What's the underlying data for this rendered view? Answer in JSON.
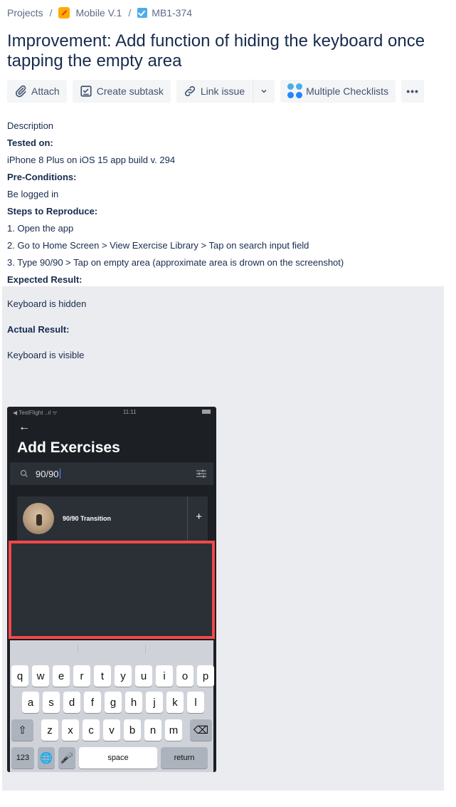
{
  "breadcrumb": {
    "projects": "Projects",
    "separator": "/",
    "project": "Mobile V.1",
    "issue_key": "MB1-374"
  },
  "issue_title": "Improvement: Add function of hiding the keyboard once tapping the empty area",
  "toolbar": {
    "attach": "Attach",
    "create_subtask": "Create subtask",
    "link_issue": "Link issue",
    "multiple_checklists": "Multiple Checklists",
    "more": "•••"
  },
  "description": {
    "heading": "Description",
    "tested_on_label": "Tested on:",
    "tested_on": "iPhone 8 Plus on iOS 15 app build v. 294",
    "preconditions_label": "Pre-Conditions:",
    "preconditions": "Be logged in",
    "steps_label": "Steps to Reproduce:",
    "steps": [
      "1. Open the app",
      "2. Go to Home Screen > View Exercise Library > Tap on search input field",
      "3. Type 90/90 > Tap on empty area (approximate area is drown on the screenshot)"
    ],
    "expected_label": "Expected Result:",
    "expected": "Keyboard is hidden",
    "actual_label": "Actual Result:",
    "actual": "Keyboard is visible"
  },
  "screenshot": {
    "status_left": "◀ TestFlight ..ıl ᯤ",
    "status_time": "11:11",
    "back": "←",
    "title": "Add Exercises",
    "search_value": "90/90",
    "item_name": "90/90 Transition",
    "add": "+",
    "keyboard": {
      "row1": [
        "q",
        "w",
        "e",
        "r",
        "t",
        "y",
        "u",
        "i",
        "o",
        "p"
      ],
      "row2": [
        "a",
        "s",
        "d",
        "f",
        "g",
        "h",
        "j",
        "k",
        "l"
      ],
      "row3": [
        "z",
        "x",
        "c",
        "v",
        "b",
        "n",
        "m"
      ],
      "numbers": "123",
      "space": "space",
      "return": "return"
    }
  }
}
